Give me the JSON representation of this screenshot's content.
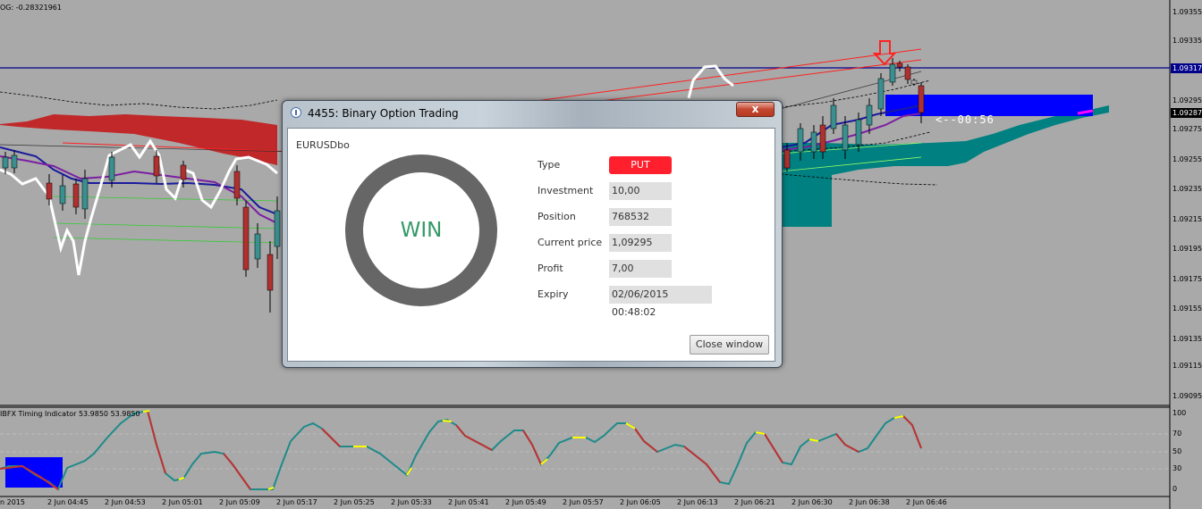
{
  "top_indicator": "OG: -0.28321961",
  "price_axis": [
    "1.09355",
    "1.09335",
    "1.09295",
    "1.09275",
    "1.09255",
    "1.09235",
    "1.09215",
    "1.09195",
    "1.09175",
    "1.09155",
    "1.09135",
    "1.09115",
    "1.09095"
  ],
  "price_tags": {
    "line_price": "1.09317",
    "current_price": "1.09287"
  },
  "countdown": "<--00:56",
  "indicator": {
    "label": "IBFX Timing Indicator 53.9850 53.9850",
    "axis": [
      "100",
      "70",
      "50",
      "30",
      "0"
    ]
  },
  "time_axis": [
    "n 2015",
    "2 Jun 04:45",
    "2 Jun 04:53",
    "2 Jun 05:01",
    "2 Jun 05:09",
    "2 Jun 05:17",
    "2 Jun 05:25",
    "2 Jun 05:33",
    "2 Jun 05:41",
    "2 Jun 05:49",
    "2 Jun 05:57",
    "2 Jun 06:05",
    "2 Jun 06:13",
    "2 Jun 06:21",
    "2 Jun 06:30",
    "2 Jun 06:38",
    "2 Jun 06:46"
  ],
  "dialog": {
    "title": "4455: Binary Option Trading",
    "close_glyph": "x",
    "symbol": "EURUSDbo",
    "result": "WIN",
    "fields": [
      {
        "label": "Type",
        "value": "PUT"
      },
      {
        "label": "Investment",
        "value": "10,00"
      },
      {
        "label": "Position",
        "value": "768532"
      },
      {
        "label": "Current price",
        "value": "1,09295"
      },
      {
        "label": "Profit",
        "value": "7,00"
      },
      {
        "label": "Expiry",
        "value": "02/06/2015 00:48:02"
      }
    ],
    "close_window_label": "Close window"
  },
  "colors": {
    "background": "#a9a9a9",
    "cloud_red": "#c0282a",
    "cloud_teal": "#008080",
    "put_red": "#ff1f2d",
    "win_green": "#339966",
    "blue_box": "#0000ff"
  }
}
